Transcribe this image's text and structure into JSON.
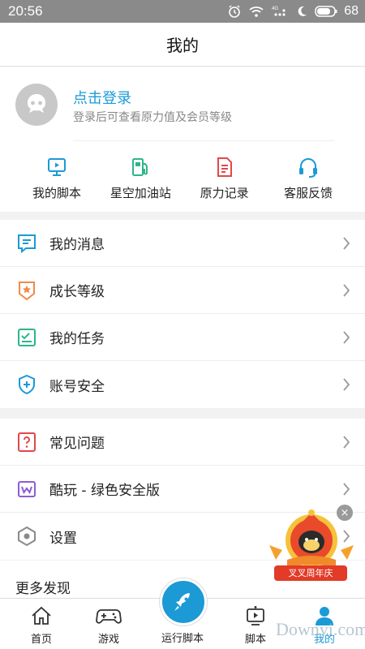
{
  "status_bar": {
    "time": "20:56",
    "battery": "68"
  },
  "header": {
    "title": "我的"
  },
  "profile": {
    "login_text": "点击登录",
    "login_hint": "登录后可查看原力值及会员等级"
  },
  "shortcuts": [
    {
      "label": "我的脚本",
      "icon": "monitor-icon",
      "color": "#1b9ad6"
    },
    {
      "label": "星空加油站",
      "icon": "fuel-pump-icon",
      "color": "#2db58c"
    },
    {
      "label": "原力记录",
      "icon": "document-icon",
      "color": "#e2474b"
    },
    {
      "label": "客服反馈",
      "icon": "headset-icon",
      "color": "#1b9ad6"
    }
  ],
  "menu_group_1": [
    {
      "label": "我的消息",
      "icon": "message-icon",
      "color": "#1b9ad6"
    },
    {
      "label": "成长等级",
      "icon": "badge-star-icon",
      "color": "#f08a4b"
    },
    {
      "label": "我的任务",
      "icon": "task-check-icon",
      "color": "#2db58c"
    },
    {
      "label": "账号安全",
      "icon": "shield-plus-icon",
      "color": "#1b9ad6"
    }
  ],
  "menu_group_2": [
    {
      "label": "常见问题",
      "icon": "question-doc-icon",
      "color": "#e2474b"
    },
    {
      "label": "酷玩 - 绿色安全版",
      "icon": "kuwan-icon",
      "color": "#8e5cd6"
    },
    {
      "label": "设置",
      "icon": "hexagon-settings-icon",
      "color": "#8a8a8a"
    }
  ],
  "more": {
    "label": "更多发现"
  },
  "tabbar": {
    "home": "首页",
    "games": "游戏",
    "run": "运行脚本",
    "scripts": "脚本",
    "mine": "我的"
  },
  "promo": {
    "text": "叉叉周年庆",
    "close": "×"
  },
  "watermark": "Downyi.com",
  "colors": {
    "accent": "#1b9ad6",
    "status_bar": "#8a8a8a"
  }
}
